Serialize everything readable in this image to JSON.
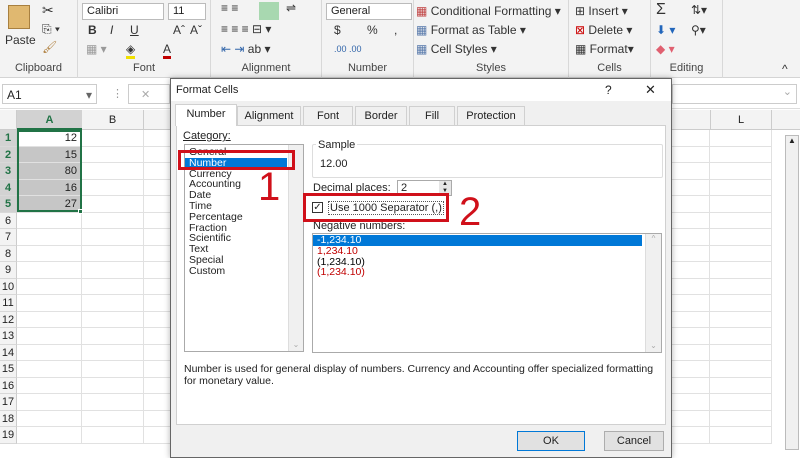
{
  "ribbon": {
    "clipboard": {
      "label": "Clipboard",
      "paste": "Paste"
    },
    "font": {
      "label": "Font",
      "name": "Calibri",
      "size": "11",
      "bold": "B",
      "italic": "I",
      "underline": "U",
      "grow": "Aˆ",
      "shrink": "Aˇ",
      "font_color": "A"
    },
    "alignment": {
      "label": "Alignment"
    },
    "number": {
      "label": "Number",
      "format": "General",
      "currency": "$",
      "percent": "%",
      "comma": ","
    },
    "styles": {
      "label": "Styles",
      "conditional": "Conditional Formatting",
      "table": "Format as Table",
      "cell_styles": "Cell Styles"
    },
    "cells": {
      "label": "Cells",
      "insert": "Insert",
      "delete": "Delete",
      "format": "Format"
    },
    "editing": {
      "label": "Editing",
      "sum": "Σ"
    }
  },
  "formula_bar": {
    "name_box": "A1",
    "cancel": "✕"
  },
  "sheet": {
    "columns": [
      "A",
      "B",
      "L"
    ],
    "rows": [
      "1",
      "2",
      "3",
      "4",
      "5",
      "6",
      "7",
      "8",
      "9",
      "10",
      "11",
      "12",
      "13",
      "14",
      "15",
      "16",
      "17",
      "18",
      "19"
    ],
    "values": [
      "12",
      "15",
      "80",
      "16",
      "27"
    ]
  },
  "dialog": {
    "title": "Format Cells",
    "help": "?",
    "close": "✕",
    "tabs": [
      "Number",
      "Alignment",
      "Font",
      "Border",
      "Fill",
      "Protection"
    ],
    "category_label": "Category:",
    "categories": [
      "General",
      "Number",
      "Currency",
      "Accounting",
      "Date",
      "Time",
      "Percentage",
      "Fraction",
      "Scientific",
      "Text",
      "Special",
      "Custom"
    ],
    "selected_category": "Number",
    "sample_label": "Sample",
    "sample_value": "12.00",
    "decimal_label": "Decimal places:",
    "decimal_value": "2",
    "separator_label": "Use 1000 Separator (,)",
    "separator_checked": true,
    "negative_label": "Negative numbers:",
    "negative_options": [
      {
        "text": "-1,234.10",
        "color": "#000000"
      },
      {
        "text": "1,234.10",
        "color": "#c00000"
      },
      {
        "text": "(1,234.10)",
        "color": "#000000"
      },
      {
        "text": "(1,234.10)",
        "color": "#c00000"
      }
    ],
    "description": "Number is used for general display of numbers.  Currency and Accounting offer specialized formatting for monetary value.",
    "ok": "OK",
    "cancel": "Cancel"
  },
  "annotations": {
    "step1": "1",
    "step2": "2",
    "color": "#d0101a"
  },
  "colors": {
    "selection": "#0078d7",
    "excel_green": "#217346"
  }
}
